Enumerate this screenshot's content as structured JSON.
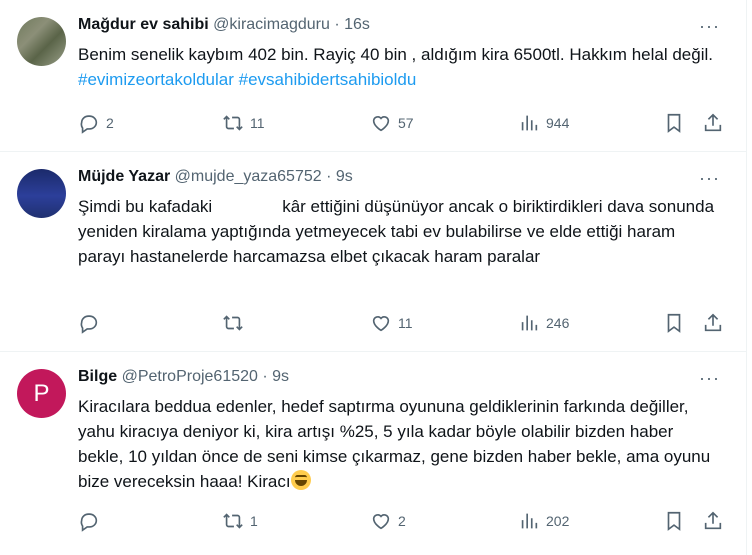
{
  "tweets": [
    {
      "name": "Mağdur ev sahibi",
      "handle": "@kiracimagduru",
      "time": "16s",
      "text_main": "Benim senelik kaybım 402 bin. Rayiç 40 bin , aldığım kira 6500tl. Hakkım helal değil. ",
      "hashtag1": "#evimizeortakoldular",
      "hashtag2": "#evsahibidertsahibioldu",
      "replies": "2",
      "retweets": "11",
      "likes": "57",
      "views": "944",
      "avatar_icon": "landscape-photo-icon"
    },
    {
      "name": "Müjde Yazar",
      "handle": "@mujde_yaza65752",
      "time": "9s",
      "text_part1": "Şimdi bu kafadaki",
      "text_part2": "kâr ettiğini düşünüyor ancak o biriktirdikleri dava sonunda yeniden kiralama yaptığında yetmeyecek tabi ev bulabilirse ve elde ettiği haram parayı hastanelerde harcamazsa elbet çıkacak haram paralar",
      "replies": "",
      "retweets": "",
      "likes": "11",
      "views": "246",
      "avatar_icon": "night-city-icon"
    },
    {
      "name": "Bilge",
      "handle": "@PetroProje61520",
      "time": "9s",
      "avatar_letter": "P",
      "text": "Kiracılara beddua edenler, hedef saptırma oyununa geldiklerinin farkında değiller, yahu kiracıya deniyor ki, kira artışı %25, 5 yıla kadar böyle olabilir bizden haber bekle, 10 yıldan önce de seni kimse çıkarmaz, gene bizden haber bekle, ama oyunu bize vereceksin haaa! Kiracı",
      "replies": "",
      "retweets": "1",
      "likes": "2",
      "views": "202"
    }
  ],
  "sep": " · ",
  "more_label": "···",
  "colors": {
    "link": "#1d9bf0",
    "muted": "#536471",
    "avatar_p": "#c2185b"
  }
}
